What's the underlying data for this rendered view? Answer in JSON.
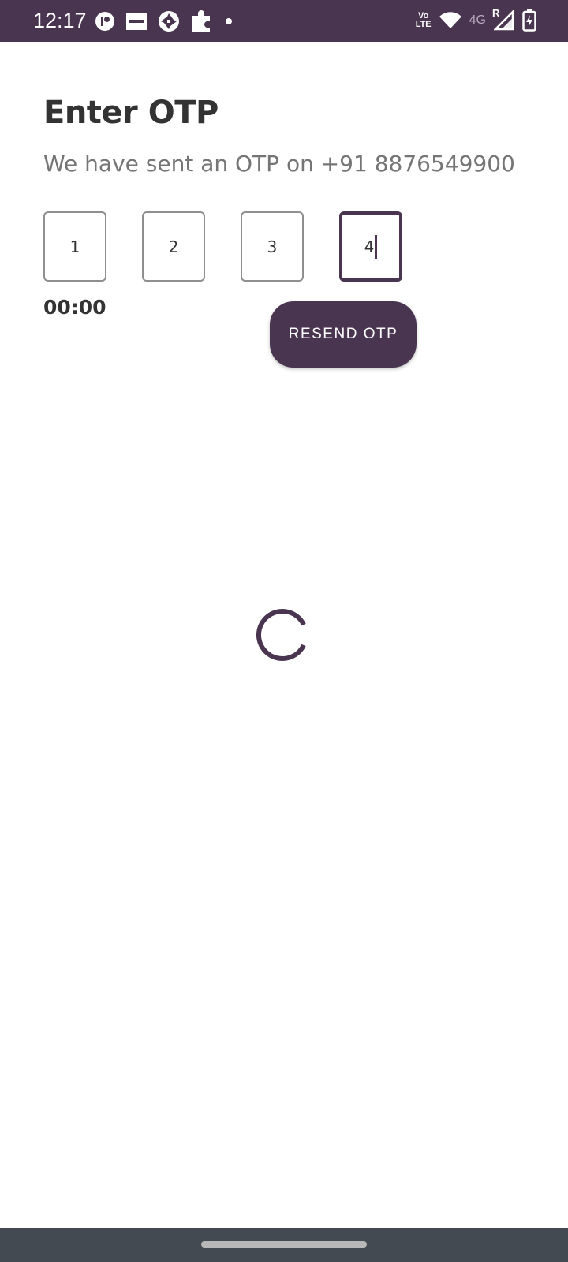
{
  "status_bar": {
    "time": "12:17",
    "volte_top": "Vo",
    "volte_bottom": "LTE",
    "network": "4G",
    "roaming": "R",
    "left_icons": [
      "notification-app-icon",
      "zomato-icon",
      "shutter-app-icon",
      "puzzle-icon",
      "more-dot-icon"
    ],
    "right_icons": [
      "volte-icon",
      "wifi-icon",
      "signal-icon",
      "battery-charging-icon"
    ]
  },
  "screen": {
    "title": "Enter OTP",
    "subtitle": "We have sent an OTP on +91 8876549900",
    "otp_digits": [
      "1",
      "2",
      "3",
      "4"
    ],
    "active_index": 3,
    "timer": "00:00",
    "resend_label": "RESEND OTP"
  },
  "colors": {
    "primary": "#4a3551",
    "title": "#333333",
    "subtitle": "#757575",
    "nav_bar": "#434a51"
  }
}
